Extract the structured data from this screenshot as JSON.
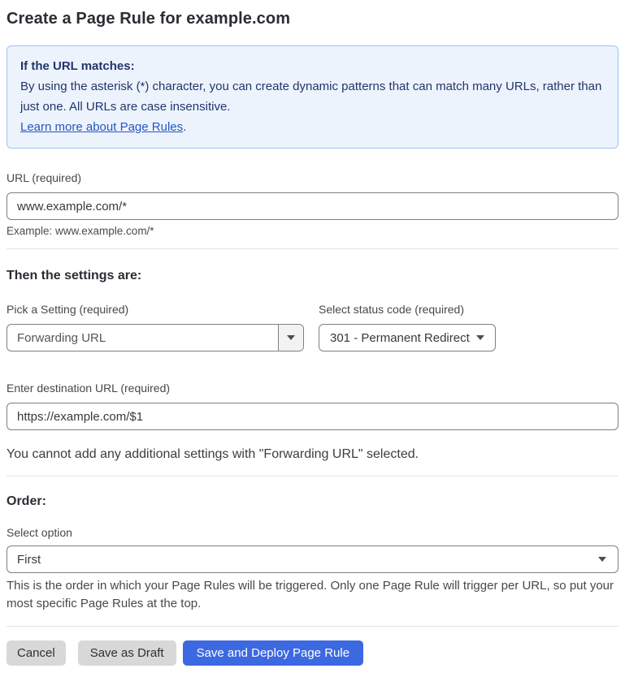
{
  "page": {
    "title": "Create a Page Rule for example.com"
  },
  "info_box": {
    "heading": "If the URL matches:",
    "body": "By using the asterisk (*) character, you can create dynamic patterns that can match many URLs, rather than just one. All URLs are case insensitive.",
    "link_label": "Learn more about Page Rules",
    "link_suffix": "."
  },
  "url_field": {
    "label": "URL (required)",
    "value": "www.example.com/*",
    "helper": "Example: www.example.com/*"
  },
  "settings": {
    "heading": "Then the settings are:",
    "setting_select": {
      "label": "Pick a Setting (required)",
      "value": "Forwarding URL"
    },
    "status_select": {
      "label": "Select status code (required)",
      "value": "301 - Permanent Redirect"
    },
    "destination_field": {
      "label": "Enter destination URL (required)",
      "value": "https://example.com/$1"
    },
    "note": "You cannot add any additional settings with \"Forwarding URL\" selected."
  },
  "order": {
    "heading": "Order:",
    "select_label": "Select option",
    "value": "First",
    "helper": "This is the order in which your Page Rules will be triggered. Only one Page Rule will trigger per URL, so put your most specific Page Rules at the top."
  },
  "actions": {
    "cancel_label": "Cancel",
    "save_draft_label": "Save as Draft",
    "save_deploy_label": "Save and Deploy Page Rule"
  },
  "colors": {
    "primary_button_blue": "#3C69E1",
    "info_box_background": "#EDF3FC",
    "info_box_border": "#9EC4EF",
    "info_box_text": "#22356B",
    "link_blue": "#2457C2"
  },
  "icons": {
    "dropdown_arrow": "chevron-down-icon"
  }
}
